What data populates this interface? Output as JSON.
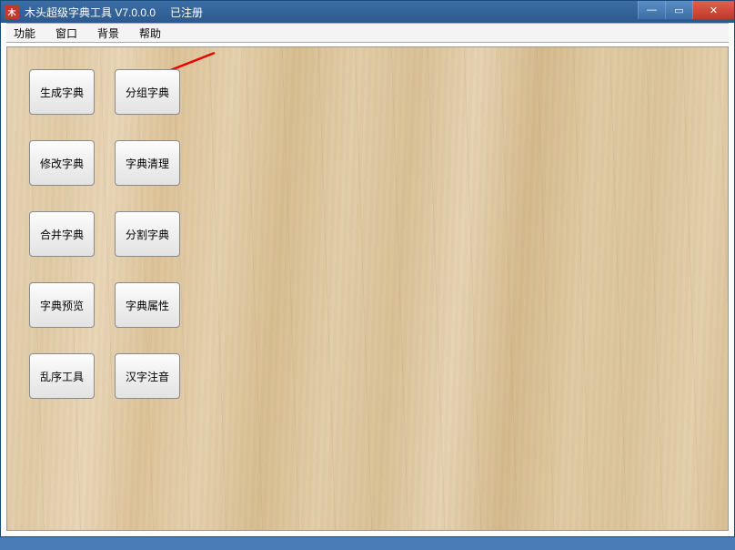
{
  "titlebar": {
    "app_icon_letter": "木",
    "title": "木头超级字典工具 V7.0.0.0",
    "registered": "已注册"
  },
  "menu": {
    "items": [
      {
        "label": "功能"
      },
      {
        "label": "窗口"
      },
      {
        "label": "背景"
      },
      {
        "label": "帮助"
      }
    ]
  },
  "tools": [
    {
      "label": "生成字典"
    },
    {
      "label": "分组字典"
    },
    {
      "label": "修改字典"
    },
    {
      "label": "字典清理"
    },
    {
      "label": "合并字典"
    },
    {
      "label": "分割字典"
    },
    {
      "label": "字典预览"
    },
    {
      "label": "字典属性"
    },
    {
      "label": "乱序工具"
    },
    {
      "label": "汉字注音"
    }
  ],
  "win_controls": {
    "minimize": "—",
    "maximize": "▭",
    "close": "✕"
  }
}
